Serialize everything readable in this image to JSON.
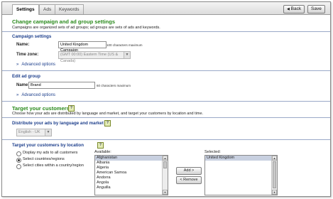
{
  "tabs": [
    {
      "label": "Settings",
      "active": true
    },
    {
      "label": "Ads",
      "active": false
    },
    {
      "label": "Keywords",
      "active": false
    }
  ],
  "toolbar": {
    "back_label": "Back",
    "save_label": "Save"
  },
  "header": {
    "title": "Change campaign and ad group settings",
    "subtitle": "Campaigns are organized sets of ad groups; ad groups are sets of ads and keywords."
  },
  "campaign_settings": {
    "heading": "Campaign settings",
    "name_label": "Name:",
    "name_value": "United Kingdom Campaign",
    "name_hint": "100 characters maximum",
    "timezone_label": "Time zone:",
    "timezone_value": "(GMT 00:00) Eastern Time (US & Canada)",
    "advanced": "Advanced options"
  },
  "ad_group": {
    "heading": "Edit ad group",
    "name_label": "Name:",
    "name_value": "Brand",
    "name_hint": "60 characters maximum",
    "advanced": "Advanced options"
  },
  "target": {
    "title": "Target your customers",
    "subtitle": "Choose how your ads are distributed by language and market, and target your customers by location and time.",
    "distribute_label": "Distribute your ads by language and market",
    "language_value": "English - UK",
    "location_label": "Target your customers by location",
    "options": [
      {
        "label": "Display my ads to all customers",
        "checked": false
      },
      {
        "label": "Select countries/regions",
        "checked": true
      },
      {
        "label": "Select cities within a country/region",
        "checked": false
      }
    ],
    "available_label": "Available:",
    "available_items": [
      "Afghanistan",
      "Albania",
      "Algeria",
      "American Samoa",
      "Andorra",
      "Angola",
      "Anguilla"
    ],
    "selected_label": "Selected:",
    "selected_items": [
      "United Kingdom"
    ],
    "add_label": "Add >",
    "remove_label": "< Remove"
  },
  "icons": {
    "help": "?",
    "chevron": "»",
    "back_arrow": "◀",
    "up": "▲",
    "down": "▼"
  }
}
